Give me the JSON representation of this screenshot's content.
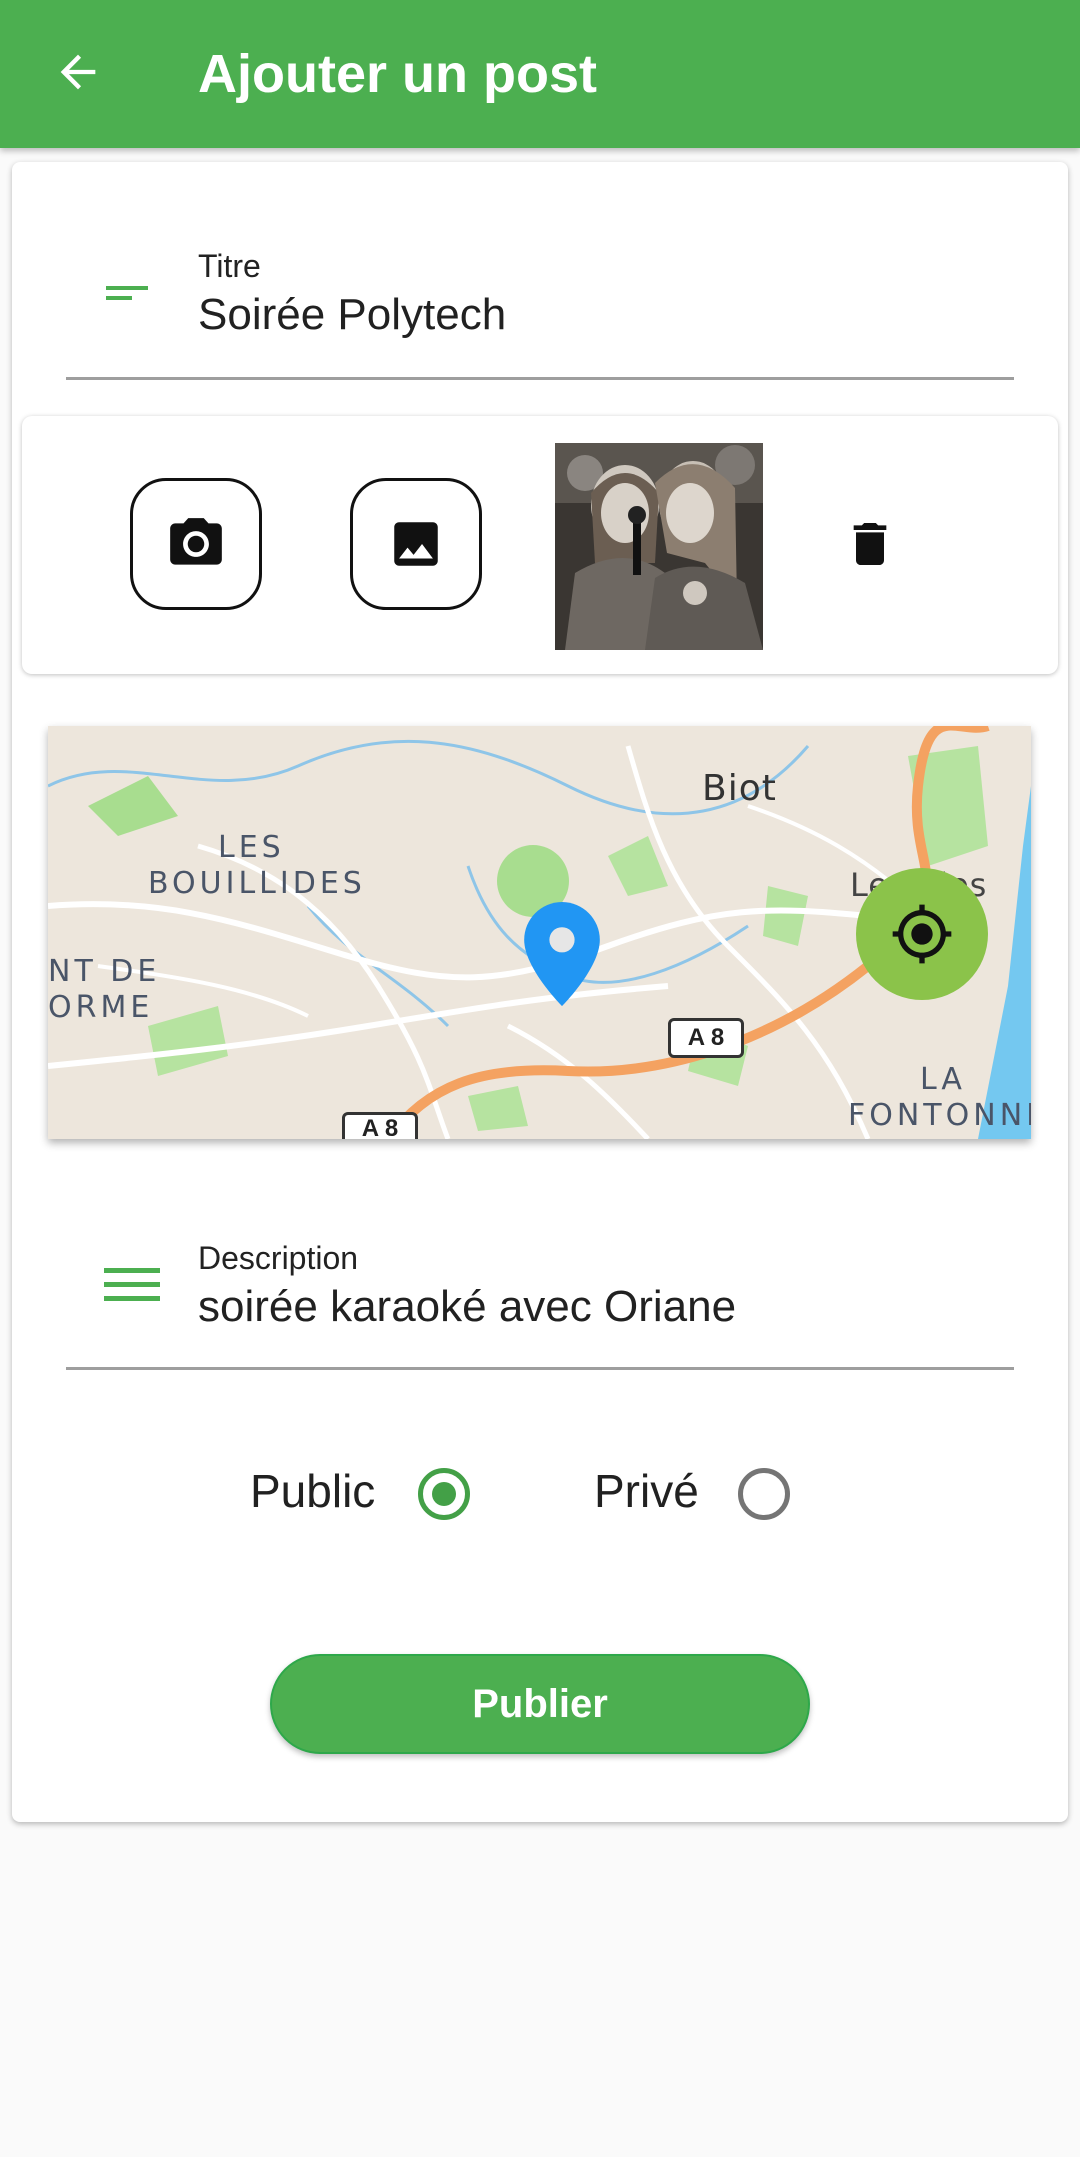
{
  "appbar": {
    "title": "Ajouter un post",
    "back_icon": "arrow-back-icon",
    "background": "#4caf50"
  },
  "title_field": {
    "label": "Titre",
    "value": "Soirée Polytech",
    "icon": "short-text-icon"
  },
  "media": {
    "camera_icon": "camera-icon",
    "gallery_icon": "image-icon",
    "thumbnail": "photo-thumbnail",
    "delete_icon": "trash-icon"
  },
  "map": {
    "labels": {
      "biot": "Biot",
      "les": "LES",
      "bouillides": "BOUILLIDES",
      "nt_de": "NT DE",
      "orme": "ORME",
      "les_ules": "Les ules",
      "la": "LA",
      "fontonne": "FONTONNE",
      "a8_upper": "A 8",
      "a8_lower": "A 8"
    },
    "marker_icon": "location-pin-icon",
    "locate_icon": "gps-target-icon",
    "locate_color": "#8bc34a"
  },
  "description_field": {
    "label": "Description",
    "value": "soirée karaoké avec Oriane",
    "icon": "notes-icon"
  },
  "visibility": {
    "public_label": "Public",
    "private_label": "Privé",
    "selected": "public"
  },
  "publish_button": {
    "label": "Publier"
  },
  "colors": {
    "accent": "#4caf50",
    "radio_selected": "#43a047",
    "radio_unselected": "#757575"
  }
}
